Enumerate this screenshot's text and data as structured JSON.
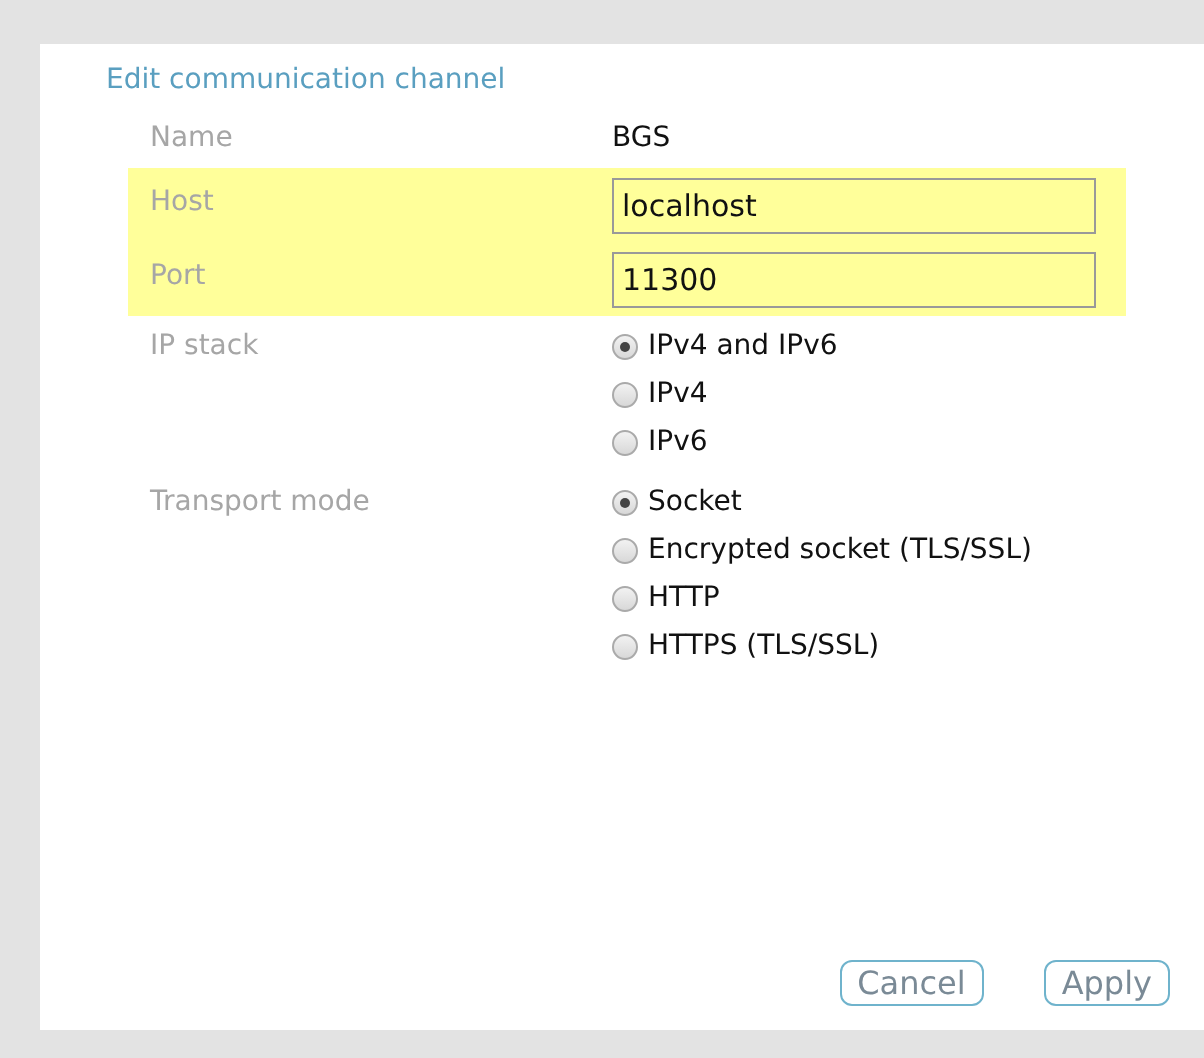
{
  "title": "Edit communication channel",
  "fields": [
    {
      "kind": "text",
      "label": "Name",
      "value": "BGS",
      "highlighted": false
    },
    {
      "kind": "input",
      "label": "Host",
      "value": "localhost",
      "highlighted": true
    },
    {
      "kind": "input",
      "label": "Port",
      "value": "11300",
      "highlighted": true
    },
    {
      "kind": "radio",
      "label": "IP stack",
      "highlighted": false,
      "options": [
        {
          "label": "IPv4 and IPv6",
          "selected": true
        },
        {
          "label": "IPv4",
          "selected": false
        },
        {
          "label": "IPv6",
          "selected": false
        }
      ]
    },
    {
      "kind": "radio",
      "label": "Transport mode",
      "highlighted": false,
      "options": [
        {
          "label": "Socket",
          "selected": true
        },
        {
          "label": "Encrypted socket (TLS/SSL)",
          "selected": false
        },
        {
          "label": "HTTP",
          "selected": false
        },
        {
          "label": "HTTPS (TLS/SSL)",
          "selected": false
        }
      ]
    }
  ],
  "buttons": [
    "Cancel",
    "Apply"
  ]
}
